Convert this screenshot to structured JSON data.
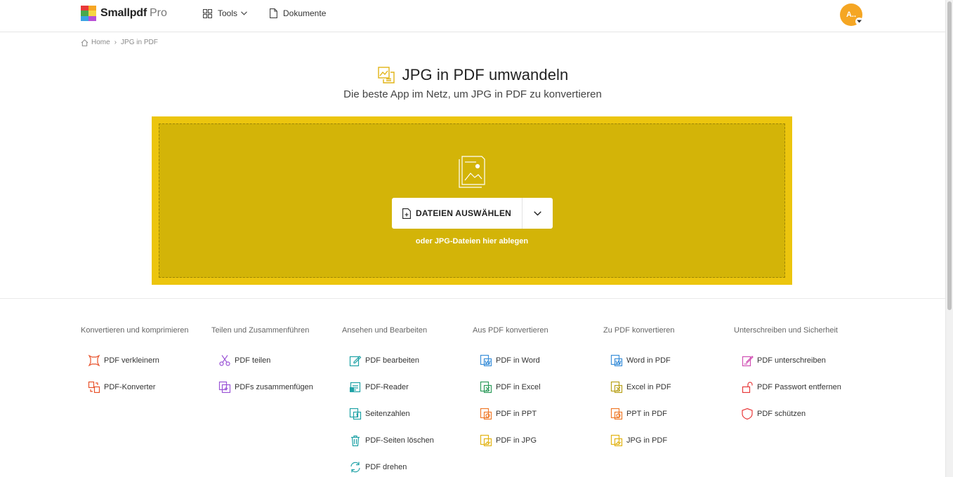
{
  "header": {
    "logo_text": "Smallpdf",
    "logo_pro": "Pro",
    "tools_label": "Tools",
    "documents_label": "Dokumente",
    "avatar_initials": "A..",
    "logo_colors": [
      "#e8393a",
      "#f6a623",
      "#49a84b",
      "#f6d743",
      "#3aa3e3",
      "#b84fd6"
    ]
  },
  "breadcrumb": {
    "home": "Home",
    "separator": "›",
    "current": "JPG in PDF"
  },
  "hero": {
    "title": "JPG in PDF umwandeln",
    "subtitle": "Die beste App im Netz, um JPG in PDF zu konvertieren",
    "accent_color": "#ecc50e"
  },
  "dropzone": {
    "button_label": "DATEIEN AUSWÄHLEN",
    "hint": "oder JPG-Dateien hier ablegen"
  },
  "tool_columns": [
    {
      "heading": "Konvertieren und komprimieren",
      "items": [
        {
          "label": "PDF verkleinern",
          "icon": "compress-icon",
          "color": "#e8512a"
        },
        {
          "label": "PDF-Konverter",
          "icon": "converter-icon",
          "color": "#e8512a"
        }
      ]
    },
    {
      "heading": "Teilen und Zusammenführen",
      "items": [
        {
          "label": "PDF teilen",
          "icon": "scissors-icon",
          "color": "#9b55d6"
        },
        {
          "label": "PDFs zusammenfügen",
          "icon": "merge-icon",
          "color": "#9b55d6"
        }
      ]
    },
    {
      "heading": "Ansehen und Bearbeiten",
      "items": [
        {
          "label": "PDF bearbeiten",
          "icon": "edit-icon",
          "color": "#1fa2a6"
        },
        {
          "label": "PDF-Reader",
          "icon": "reader-icon",
          "color": "#1fa2a6"
        },
        {
          "label": "Seitenzahlen",
          "icon": "page-numbers-icon",
          "color": "#1fa2a6"
        },
        {
          "label": "PDF-Seiten löschen",
          "icon": "trash-icon",
          "color": "#1fa2a6"
        },
        {
          "label": "PDF drehen",
          "icon": "rotate-icon",
          "color": "#1fa2a6"
        }
      ]
    },
    {
      "heading": "Aus PDF konvertieren",
      "items": [
        {
          "label": "PDF in Word",
          "icon": "word-icon",
          "color": "#3b8fd9"
        },
        {
          "label": "PDF in Excel",
          "icon": "excel-icon",
          "color": "#2e9c5c"
        },
        {
          "label": "PDF in PPT",
          "icon": "ppt-icon",
          "color": "#ef7a2a"
        },
        {
          "label": "PDF in JPG",
          "icon": "jpg-icon",
          "color": "#e2b315"
        }
      ]
    },
    {
      "heading": "Zu PDF konvertieren",
      "items": [
        {
          "label": "Word in PDF",
          "icon": "word-icon",
          "color": "#3b8fd9"
        },
        {
          "label": "Excel in PDF",
          "icon": "excel-icon",
          "color": "#b8a11a"
        },
        {
          "label": "PPT in PDF",
          "icon": "ppt-icon",
          "color": "#ef7a2a"
        },
        {
          "label": "JPG in PDF",
          "icon": "jpg-icon",
          "color": "#e2b315"
        }
      ]
    },
    {
      "heading": "Unterschreiben und Sicherheit",
      "items": [
        {
          "label": "PDF unterschreiben",
          "icon": "sign-icon",
          "color": "#d14fb3"
        },
        {
          "label": "PDF Passwort entfernen",
          "icon": "unlock-icon",
          "color": "#e8393a"
        },
        {
          "label": "PDF schützen",
          "icon": "shield-icon",
          "color": "#e8393a"
        }
      ]
    }
  ]
}
